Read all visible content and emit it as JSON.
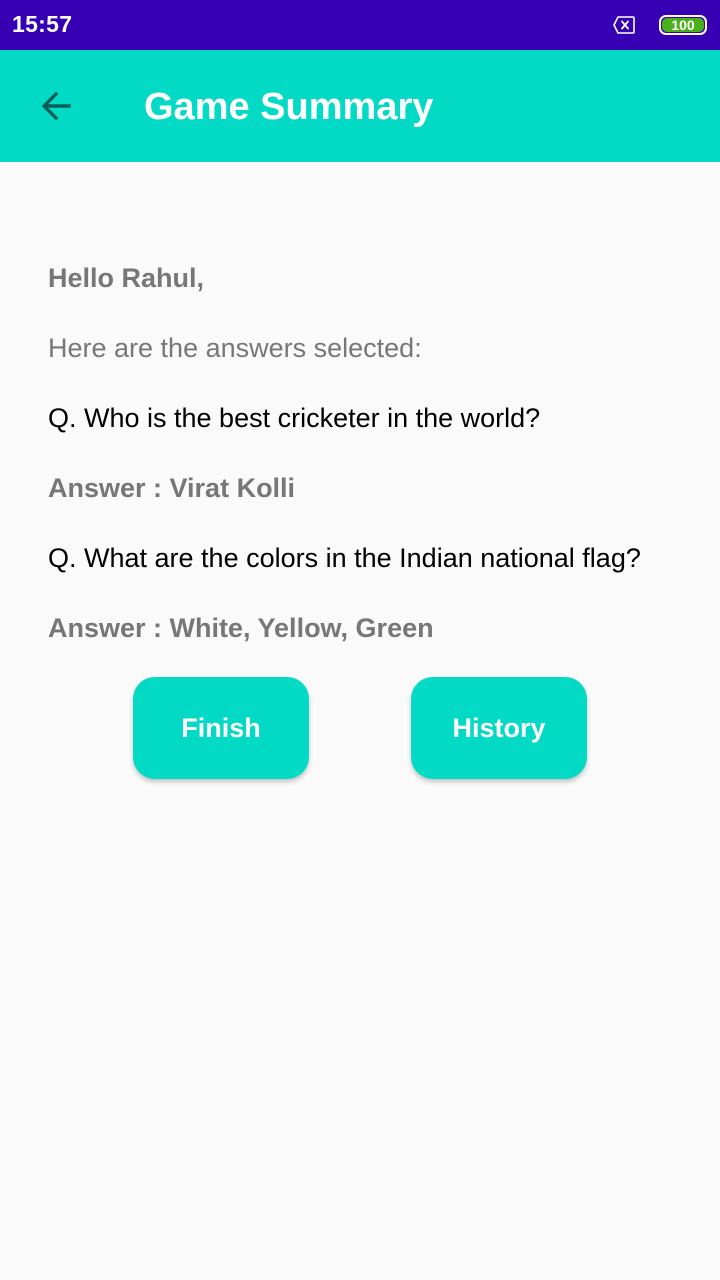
{
  "status_bar": {
    "time": "15:57",
    "battery_level": "100",
    "icons": [
      "sim-off-icon",
      "battery-icon"
    ]
  },
  "app_bar": {
    "title": "Game Summary",
    "back_icon": "arrow-left-icon"
  },
  "summary": {
    "greeting": "Hello Rahul,",
    "intro": "Here are the answers selected:",
    "questions": [
      {
        "question": "Q. Who is the best cricketer in the world?",
        "answer": "Answer : Virat Kolli"
      },
      {
        "question": "Q. What are the colors in the Indian national flag?",
        "answer": "Answer : White, Yellow, Green"
      }
    ]
  },
  "actions": {
    "finish_label": "Finish",
    "history_label": "History"
  },
  "colors": {
    "status_bar": "#3700B3",
    "accent": "#03DAC5",
    "muted_text": "#777777",
    "body_text": "#000000",
    "background": "#FAFAFA",
    "battery": "#4CAF1E"
  }
}
